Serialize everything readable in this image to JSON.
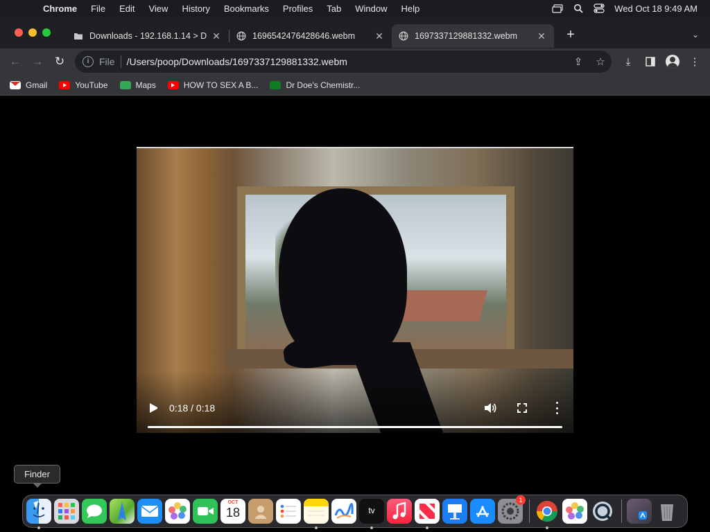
{
  "menubar": {
    "app_name": "Chrome",
    "items": [
      "File",
      "Edit",
      "View",
      "History",
      "Bookmarks",
      "Profiles",
      "Tab",
      "Window",
      "Help"
    ],
    "clock": "Wed Oct 18  9:49 AM"
  },
  "tabs": [
    {
      "title": "Downloads - 192.168.1.14 > D",
      "icon": "folder-icon"
    },
    {
      "title": "1696542476428646.webm",
      "icon": "globe-icon"
    },
    {
      "title": "1697337129881332.webm",
      "icon": "globe-icon",
      "active": true
    }
  ],
  "omnibox": {
    "scheme_label": "File",
    "url": "/Users/poop/Downloads/1697337129881332.webm"
  },
  "bookmarks": [
    {
      "label": "Gmail",
      "icon": "gmail-icon"
    },
    {
      "label": "YouTube",
      "icon": "youtube-icon"
    },
    {
      "label": "Maps",
      "icon": "maps-icon"
    },
    {
      "label": "HOW TO SEX A B...",
      "icon": "youtube-icon"
    },
    {
      "label": "Dr Doe's Chemistr...",
      "icon": "site-icon"
    }
  ],
  "video": {
    "time": "0:18 / 0:18",
    "progress_fraction": 1.0
  },
  "dock": {
    "tooltip": "Finder",
    "calendar_month": "OCT",
    "calendar_day": "18",
    "tv_label": "tv",
    "settings_badge": "1",
    "items": [
      "finder-icon",
      "launchpad-icon",
      "messages-icon",
      "maps-icon",
      "mail-icon",
      "photos-icon",
      "facetime-icon",
      "calendar-icon",
      "contacts-icon",
      "reminders-icon",
      "notes-icon",
      "freeform-icon",
      "tv-icon",
      "music-icon",
      "news-icon",
      "keynote-icon",
      "app-store-icon",
      "system-settings-icon",
      "chrome-icon",
      "photos-icon",
      "quicktime-icon",
      "downloads-stack-icon",
      "trash-icon"
    ]
  }
}
